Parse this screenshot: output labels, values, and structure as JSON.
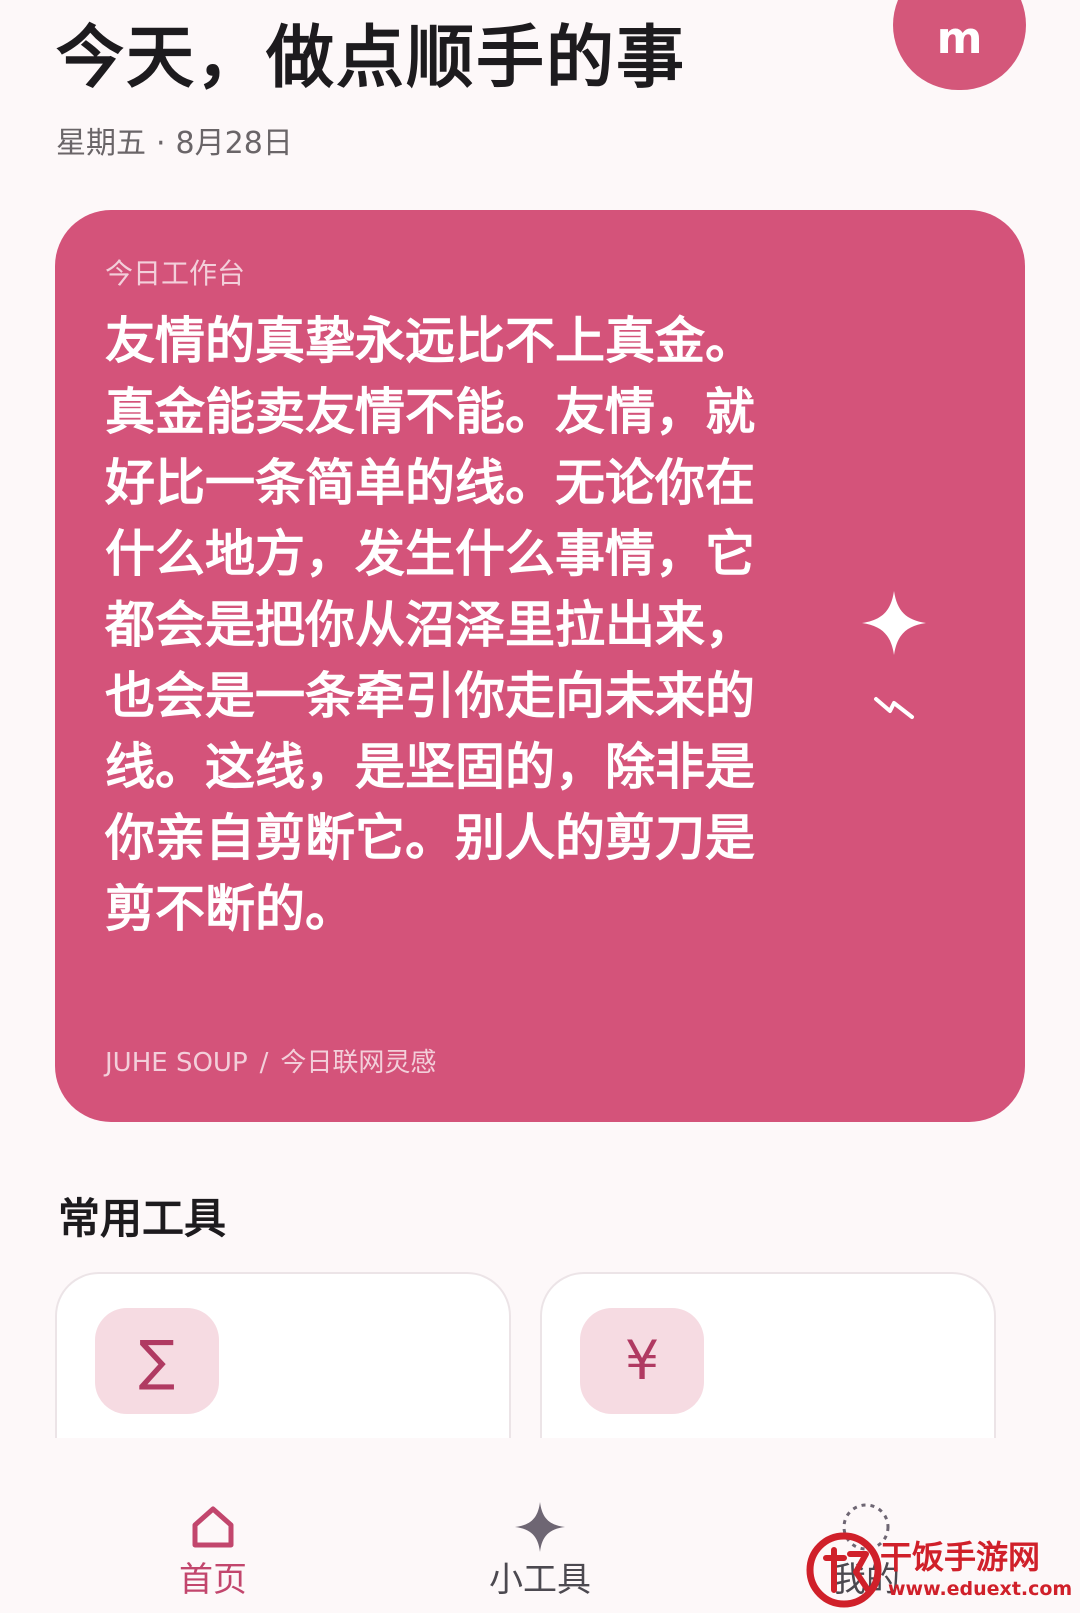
{
  "header": {
    "title": "今天，做点顺手的事",
    "avatar_letter": "m",
    "weekday": "星期五",
    "separator": "·",
    "date": "8月28日"
  },
  "hero": {
    "eyebrow": "今日工作台",
    "quote": "友情的真挚永远比不上真金。真金能卖友情不能。友情，就好比一条简单的线。无论你在什么地方，发生什么事情，它都会是把你从沼泽里拉出来，也会是一条牵引你走向未来的线。这线，是坚固的，除非是你亲自剪断它。别人的剪刀是剪不断的。",
    "source_brand": "JUHE SOUP",
    "source_sep": "/",
    "source_label": "今日联网灵感",
    "actions": [
      "sparkle-icon",
      "bolt-icon"
    ]
  },
  "tools_section": {
    "title": "常用工具",
    "tools": [
      {
        "symbol": "∑",
        "icon": "sigma-icon"
      },
      {
        "symbol": "¥",
        "icon": "yen-icon"
      }
    ]
  },
  "nav": {
    "items": [
      {
        "label": "首页",
        "icon": "home-icon",
        "active": true
      },
      {
        "label": "小工具",
        "icon": "sparkle-icon",
        "active": false
      },
      {
        "label": "我的",
        "icon": "profile-icon",
        "active": false
      }
    ]
  },
  "watermark": {
    "name": "干饭手游网",
    "url": "www.eduext.com"
  },
  "colors": {
    "accent": "#d4537a",
    "accent_light": "#f6dbe2",
    "nav_active": "#c2466d",
    "background": "#fdf8f9",
    "watermark": "#d0202a"
  }
}
